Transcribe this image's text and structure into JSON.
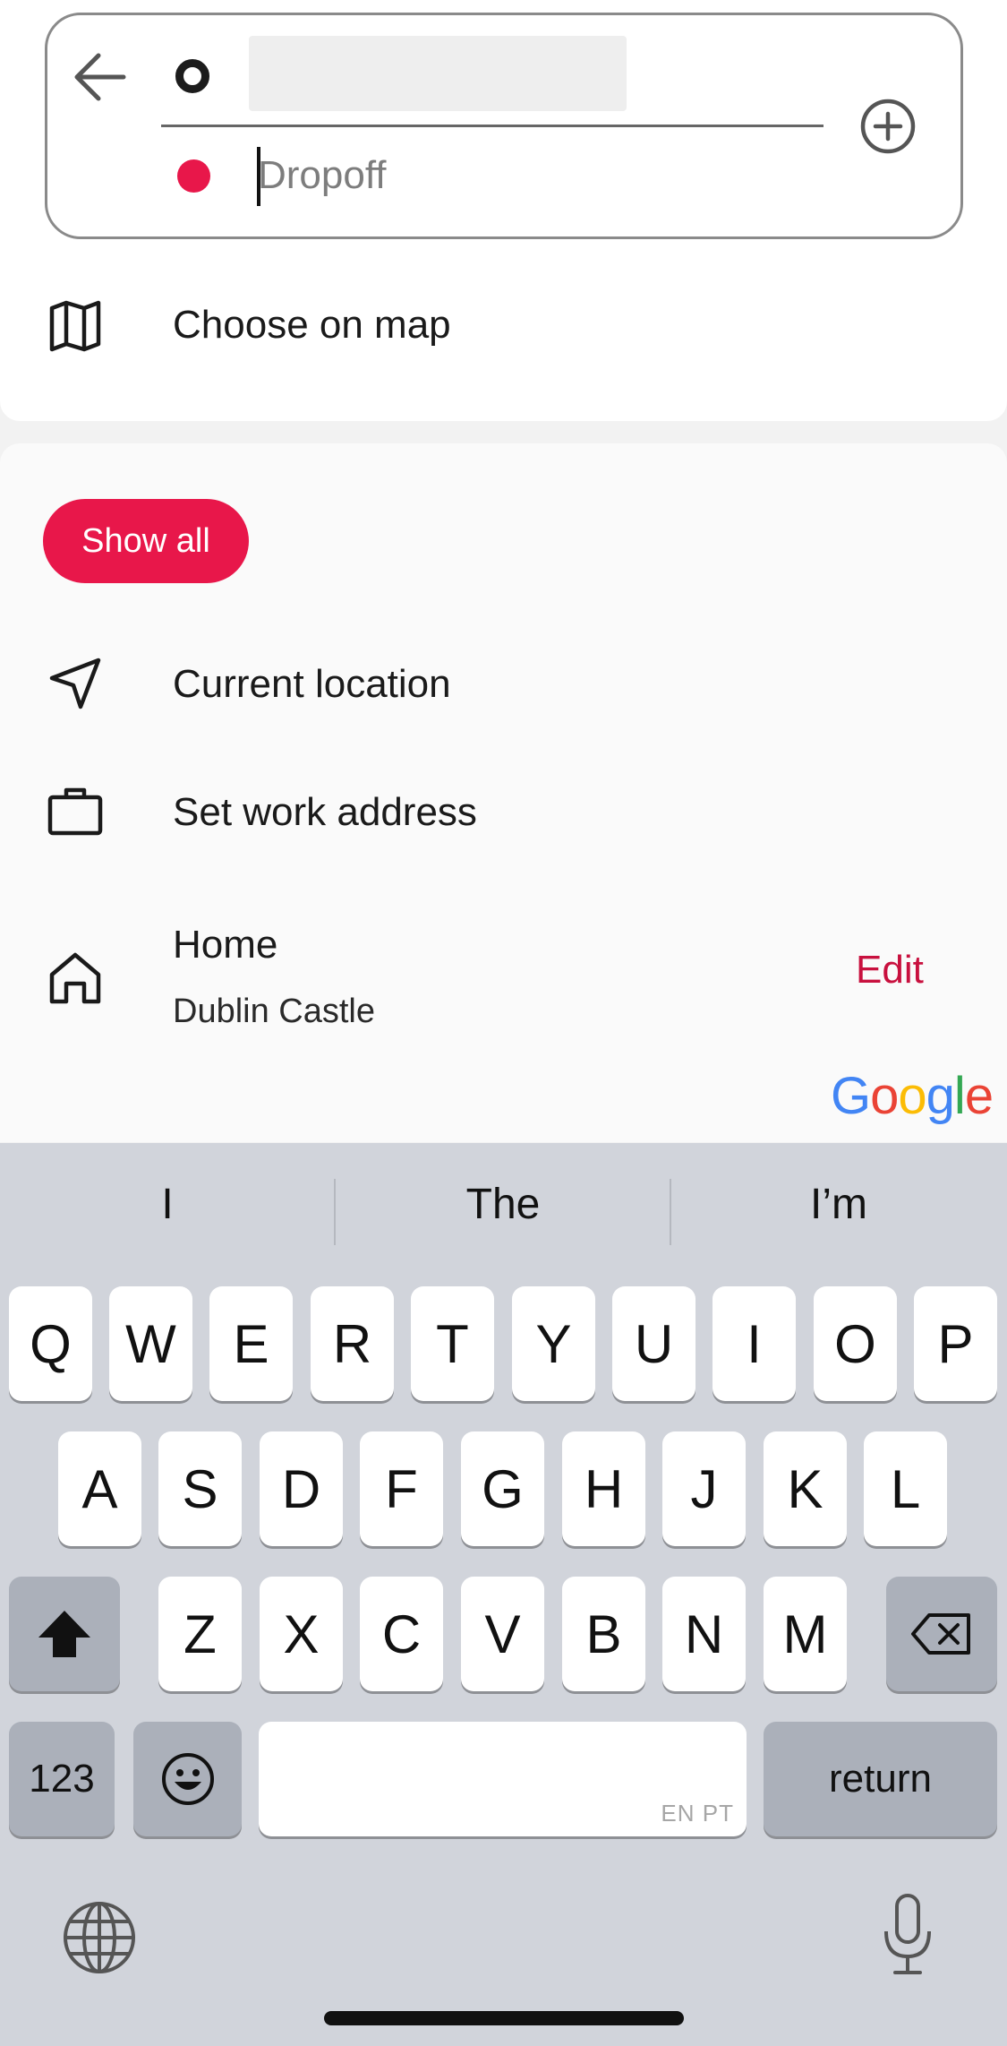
{
  "search": {
    "pickup_value": "",
    "dropoff_placeholder": "Dropoff",
    "accent": "#e8174a"
  },
  "choose_on_map": {
    "label": "Choose on map",
    "icon": "map-icon"
  },
  "show_all": {
    "label": "Show all"
  },
  "places": [
    {
      "label": "Current location",
      "icon": "navigation-arrow-icon"
    },
    {
      "label": "Set work address",
      "icon": "briefcase-icon"
    },
    {
      "label": "Home",
      "sublabel": "Dublin Castle",
      "action": "Edit",
      "icon": "home-icon"
    }
  ],
  "branding": {
    "google": [
      "G",
      "o",
      "o",
      "g",
      "l",
      "e"
    ]
  },
  "keyboard": {
    "suggestions": [
      "I",
      "The",
      "I’m"
    ],
    "row1": [
      "Q",
      "W",
      "E",
      "R",
      "T",
      "Y",
      "U",
      "I",
      "O",
      "P"
    ],
    "row2": [
      "A",
      "S",
      "D",
      "F",
      "G",
      "H",
      "J",
      "K",
      "L"
    ],
    "row3": [
      "Z",
      "X",
      "C",
      "V",
      "B",
      "N",
      "M"
    ],
    "numbers_label": "123",
    "return_label": "return",
    "space_hint": "EN PT"
  }
}
